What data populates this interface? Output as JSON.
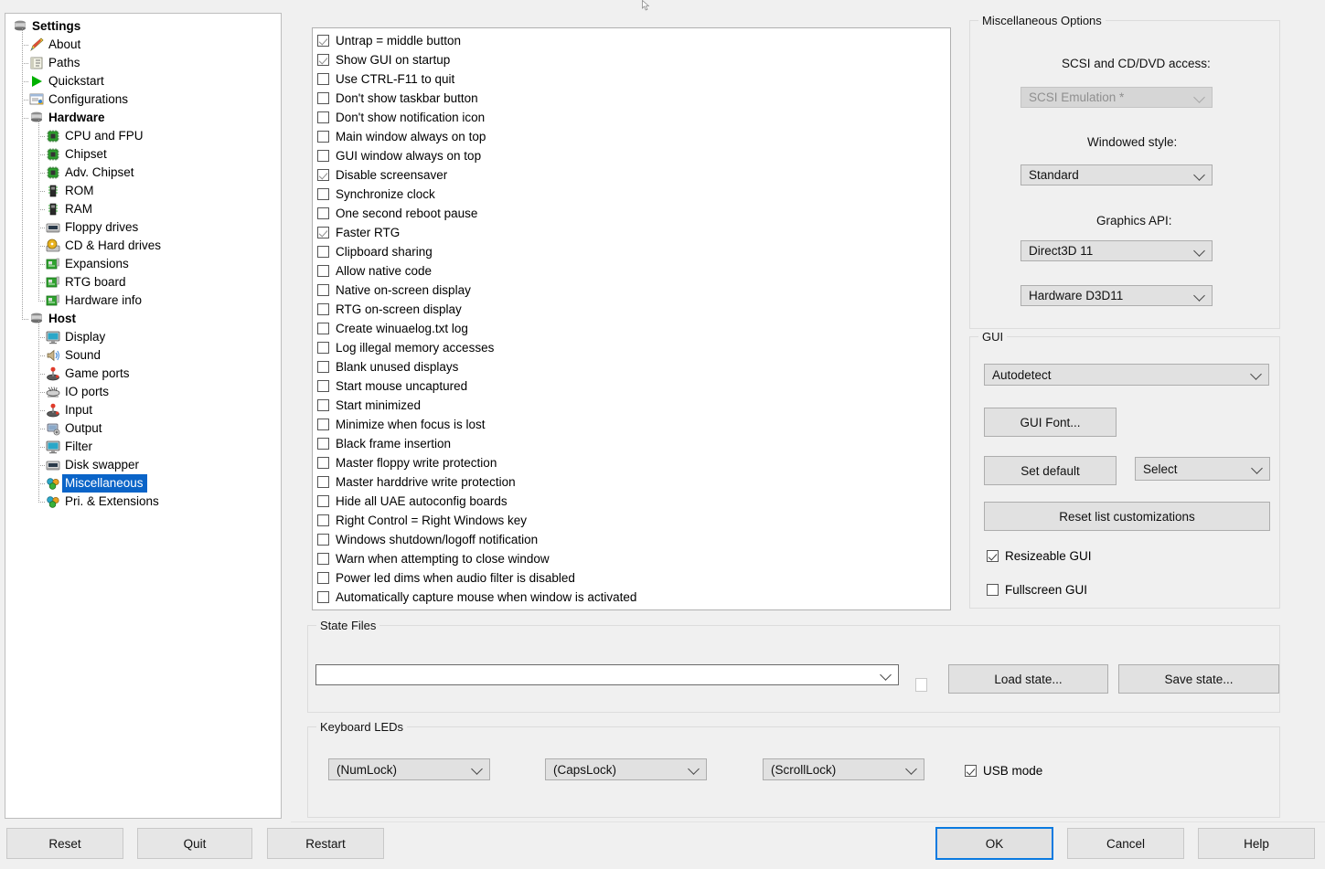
{
  "sidebar": {
    "items": [
      {
        "label": "Settings",
        "icon": "stack-icon",
        "indent": 0,
        "bold": true,
        "selected": false
      },
      {
        "label": "About",
        "icon": "pencil-icon",
        "indent": 1,
        "bold": false,
        "selected": false
      },
      {
        "label": "Paths",
        "icon": "paths-icon",
        "indent": 1,
        "bold": false,
        "selected": false
      },
      {
        "label": "Quickstart",
        "icon": "play-icon",
        "indent": 1,
        "bold": false,
        "selected": false
      },
      {
        "label": "Configurations",
        "icon": "config-icon",
        "indent": 1,
        "bold": false,
        "selected": false
      },
      {
        "label": "Hardware",
        "icon": "stack-icon",
        "indent": 1,
        "bold": true,
        "selected": false
      },
      {
        "label": "CPU and FPU",
        "icon": "chip-icon",
        "indent": 2,
        "bold": false,
        "selected": false
      },
      {
        "label": "Chipset",
        "icon": "chip-icon",
        "indent": 2,
        "bold": false,
        "selected": false
      },
      {
        "label": "Adv. Chipset",
        "icon": "chip-icon",
        "indent": 2,
        "bold": false,
        "selected": false
      },
      {
        "label": "ROM",
        "icon": "memory-icon",
        "indent": 2,
        "bold": false,
        "selected": false
      },
      {
        "label": "RAM",
        "icon": "memory-icon",
        "indent": 2,
        "bold": false,
        "selected": false
      },
      {
        "label": "Floppy drives",
        "icon": "floppy-icon",
        "indent": 2,
        "bold": false,
        "selected": false
      },
      {
        "label": "CD & Hard drives",
        "icon": "cd-icon",
        "indent": 2,
        "bold": false,
        "selected": false
      },
      {
        "label": "Expansions",
        "icon": "board-icon",
        "indent": 2,
        "bold": false,
        "selected": false
      },
      {
        "label": "RTG board",
        "icon": "board-icon",
        "indent": 2,
        "bold": false,
        "selected": false
      },
      {
        "label": "Hardware info",
        "icon": "board-icon",
        "indent": 2,
        "bold": false,
        "selected": false
      },
      {
        "label": "Host",
        "icon": "stack-icon",
        "indent": 1,
        "bold": true,
        "selected": false
      },
      {
        "label": "Display",
        "icon": "monitor-icon",
        "indent": 2,
        "bold": false,
        "selected": false
      },
      {
        "label": "Sound",
        "icon": "speaker-icon",
        "indent": 2,
        "bold": false,
        "selected": false
      },
      {
        "label": "Game ports",
        "icon": "joystick-icon",
        "indent": 2,
        "bold": false,
        "selected": false
      },
      {
        "label": "IO ports",
        "icon": "ioports-icon",
        "indent": 2,
        "bold": false,
        "selected": false
      },
      {
        "label": "Input",
        "icon": "joystick-icon",
        "indent": 2,
        "bold": false,
        "selected": false
      },
      {
        "label": "Output",
        "icon": "output-icon",
        "indent": 2,
        "bold": false,
        "selected": false
      },
      {
        "label": "Filter",
        "icon": "monitor-icon",
        "indent": 2,
        "bold": false,
        "selected": false
      },
      {
        "label": "Disk swapper",
        "icon": "floppy-icon",
        "indent": 2,
        "bold": false,
        "selected": false
      },
      {
        "label": "Miscellaneous",
        "icon": "cubes-icon",
        "indent": 2,
        "bold": false,
        "selected": true
      },
      {
        "label": "Pri. & Extensions",
        "icon": "cubes-icon",
        "indent": 2,
        "bold": false,
        "selected": false
      }
    ]
  },
  "options_list": [
    {
      "label": "Untrap = middle button",
      "checked": true
    },
    {
      "label": "Show GUI on startup",
      "checked": true
    },
    {
      "label": "Use CTRL-F11 to quit",
      "checked": false
    },
    {
      "label": "Don't show taskbar button",
      "checked": false
    },
    {
      "label": "Don't show notification icon",
      "checked": false
    },
    {
      "label": "Main window always on top",
      "checked": false
    },
    {
      "label": "GUI window always on top",
      "checked": false
    },
    {
      "label": "Disable screensaver",
      "checked": true
    },
    {
      "label": "Synchronize clock",
      "checked": false
    },
    {
      "label": "One second reboot pause",
      "checked": false
    },
    {
      "label": "Faster RTG",
      "checked": true
    },
    {
      "label": "Clipboard sharing",
      "checked": false
    },
    {
      "label": "Allow native code",
      "checked": false
    },
    {
      "label": "Native on-screen display",
      "checked": false
    },
    {
      "label": "RTG on-screen display",
      "checked": false
    },
    {
      "label": "Create winuaelog.txt log",
      "checked": false
    },
    {
      "label": "Log illegal memory accesses",
      "checked": false
    },
    {
      "label": "Blank unused displays",
      "checked": false
    },
    {
      "label": "Start mouse uncaptured",
      "checked": false
    },
    {
      "label": "Start minimized",
      "checked": false
    },
    {
      "label": "Minimize when focus is lost",
      "checked": false
    },
    {
      "label": "Black frame insertion",
      "checked": false
    },
    {
      "label": "Master floppy write protection",
      "checked": false
    },
    {
      "label": "Master harddrive write protection",
      "checked": false
    },
    {
      "label": "Hide all UAE autoconfig boards",
      "checked": false
    },
    {
      "label": "Right Control = Right Windows key",
      "checked": false
    },
    {
      "label": "Windows shutdown/logoff notification",
      "checked": false
    },
    {
      "label": "Warn when attempting to close window",
      "checked": false
    },
    {
      "label": "Power led dims when audio filter is disabled",
      "checked": false
    },
    {
      "label": "Automatically capture mouse when window is activated",
      "checked": false
    }
  ],
  "misc_options": {
    "title": "Miscellaneous Options",
    "scsi_label": "SCSI and CD/DVD access:",
    "scsi_value": "SCSI Emulation *",
    "windowed_label": "Windowed style:",
    "windowed_value": "Standard",
    "graphics_label": "Graphics API:",
    "graphics_value": "Direct3D 11",
    "graphics_mode_value": "Hardware D3D11"
  },
  "gui_group": {
    "title": "GUI",
    "theme_value": "Autodetect",
    "font_button": "GUI Font...",
    "set_default_button": "Set default",
    "select_value": "Select",
    "reset_list_button": "Reset list customizations",
    "resizeable_label": "Resizeable GUI",
    "resizeable_checked": true,
    "fullscreen_label": "Fullscreen GUI",
    "fullscreen_checked": false
  },
  "state_files": {
    "title": "State Files",
    "path_value": "",
    "extra_checkbox_checked": false,
    "load_button": "Load state...",
    "save_button": "Save state..."
  },
  "keyboard_leds": {
    "title": "Keyboard LEDs",
    "numlock_value": "(NumLock)",
    "capslock_value": "(CapsLock)",
    "scrolllock_value": "(ScrollLock)",
    "usb_mode_label": "USB mode",
    "usb_mode_checked": true
  },
  "bottom_bar": {
    "reset": "Reset",
    "quit": "Quit",
    "restart": "Restart",
    "ok": "OK",
    "cancel": "Cancel",
    "help": "Help"
  },
  "colors": {
    "selection_blue": "#0a64c8",
    "default_button_border": "#0a7ae0",
    "window_bg": "#f0f0f0",
    "control_bg": "#e1e1e1"
  }
}
